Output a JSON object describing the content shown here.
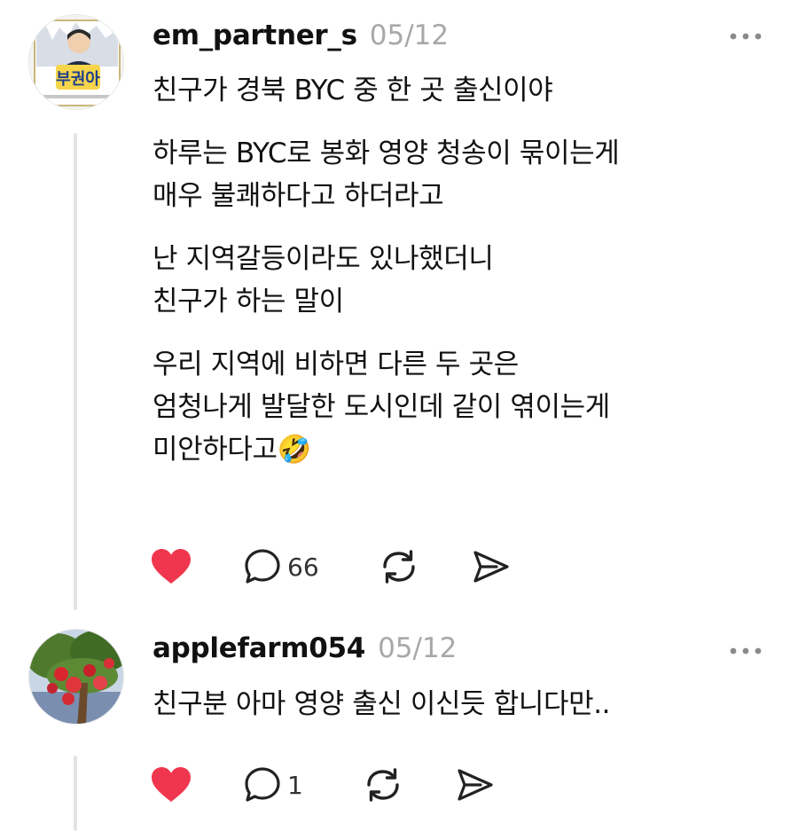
{
  "posts": [
    {
      "username": "em_partner_s",
      "date": "05/12",
      "avatar": {
        "icon": "profile-photo-badge",
        "text": "부권아"
      },
      "paragraphs": [
        [
          "친구가 경북 BYC 중 한 곳 출신이야"
        ],
        [
          "하루는 BYC로 봉화 영양 청송이 묶이는게",
          "매우 불쾌하다고 하더라고"
        ],
        [
          "난 지역갈등이라도 있나했더니",
          "친구가 하는 말이"
        ],
        [
          "우리 지역에 비하면 다른 두 곳은",
          "엄청나게 발달한 도시인데 같이 엮이는게",
          "미안하다고🤣"
        ]
      ],
      "actions": {
        "liked": true,
        "comment_count": "66"
      }
    },
    {
      "username": "applefarm054",
      "date": "05/12",
      "avatar": {
        "icon": "apple-tree-photo"
      },
      "paragraphs": [
        [
          "친구분 아마 영양 출신 이신듯 합니다만.."
        ]
      ],
      "actions": {
        "liked": true,
        "comment_count": "1"
      }
    }
  ],
  "colors": {
    "like": "#f0364e",
    "icon": "#222222",
    "muted": "#a8a8a8",
    "thread": "#e3e3e3"
  }
}
